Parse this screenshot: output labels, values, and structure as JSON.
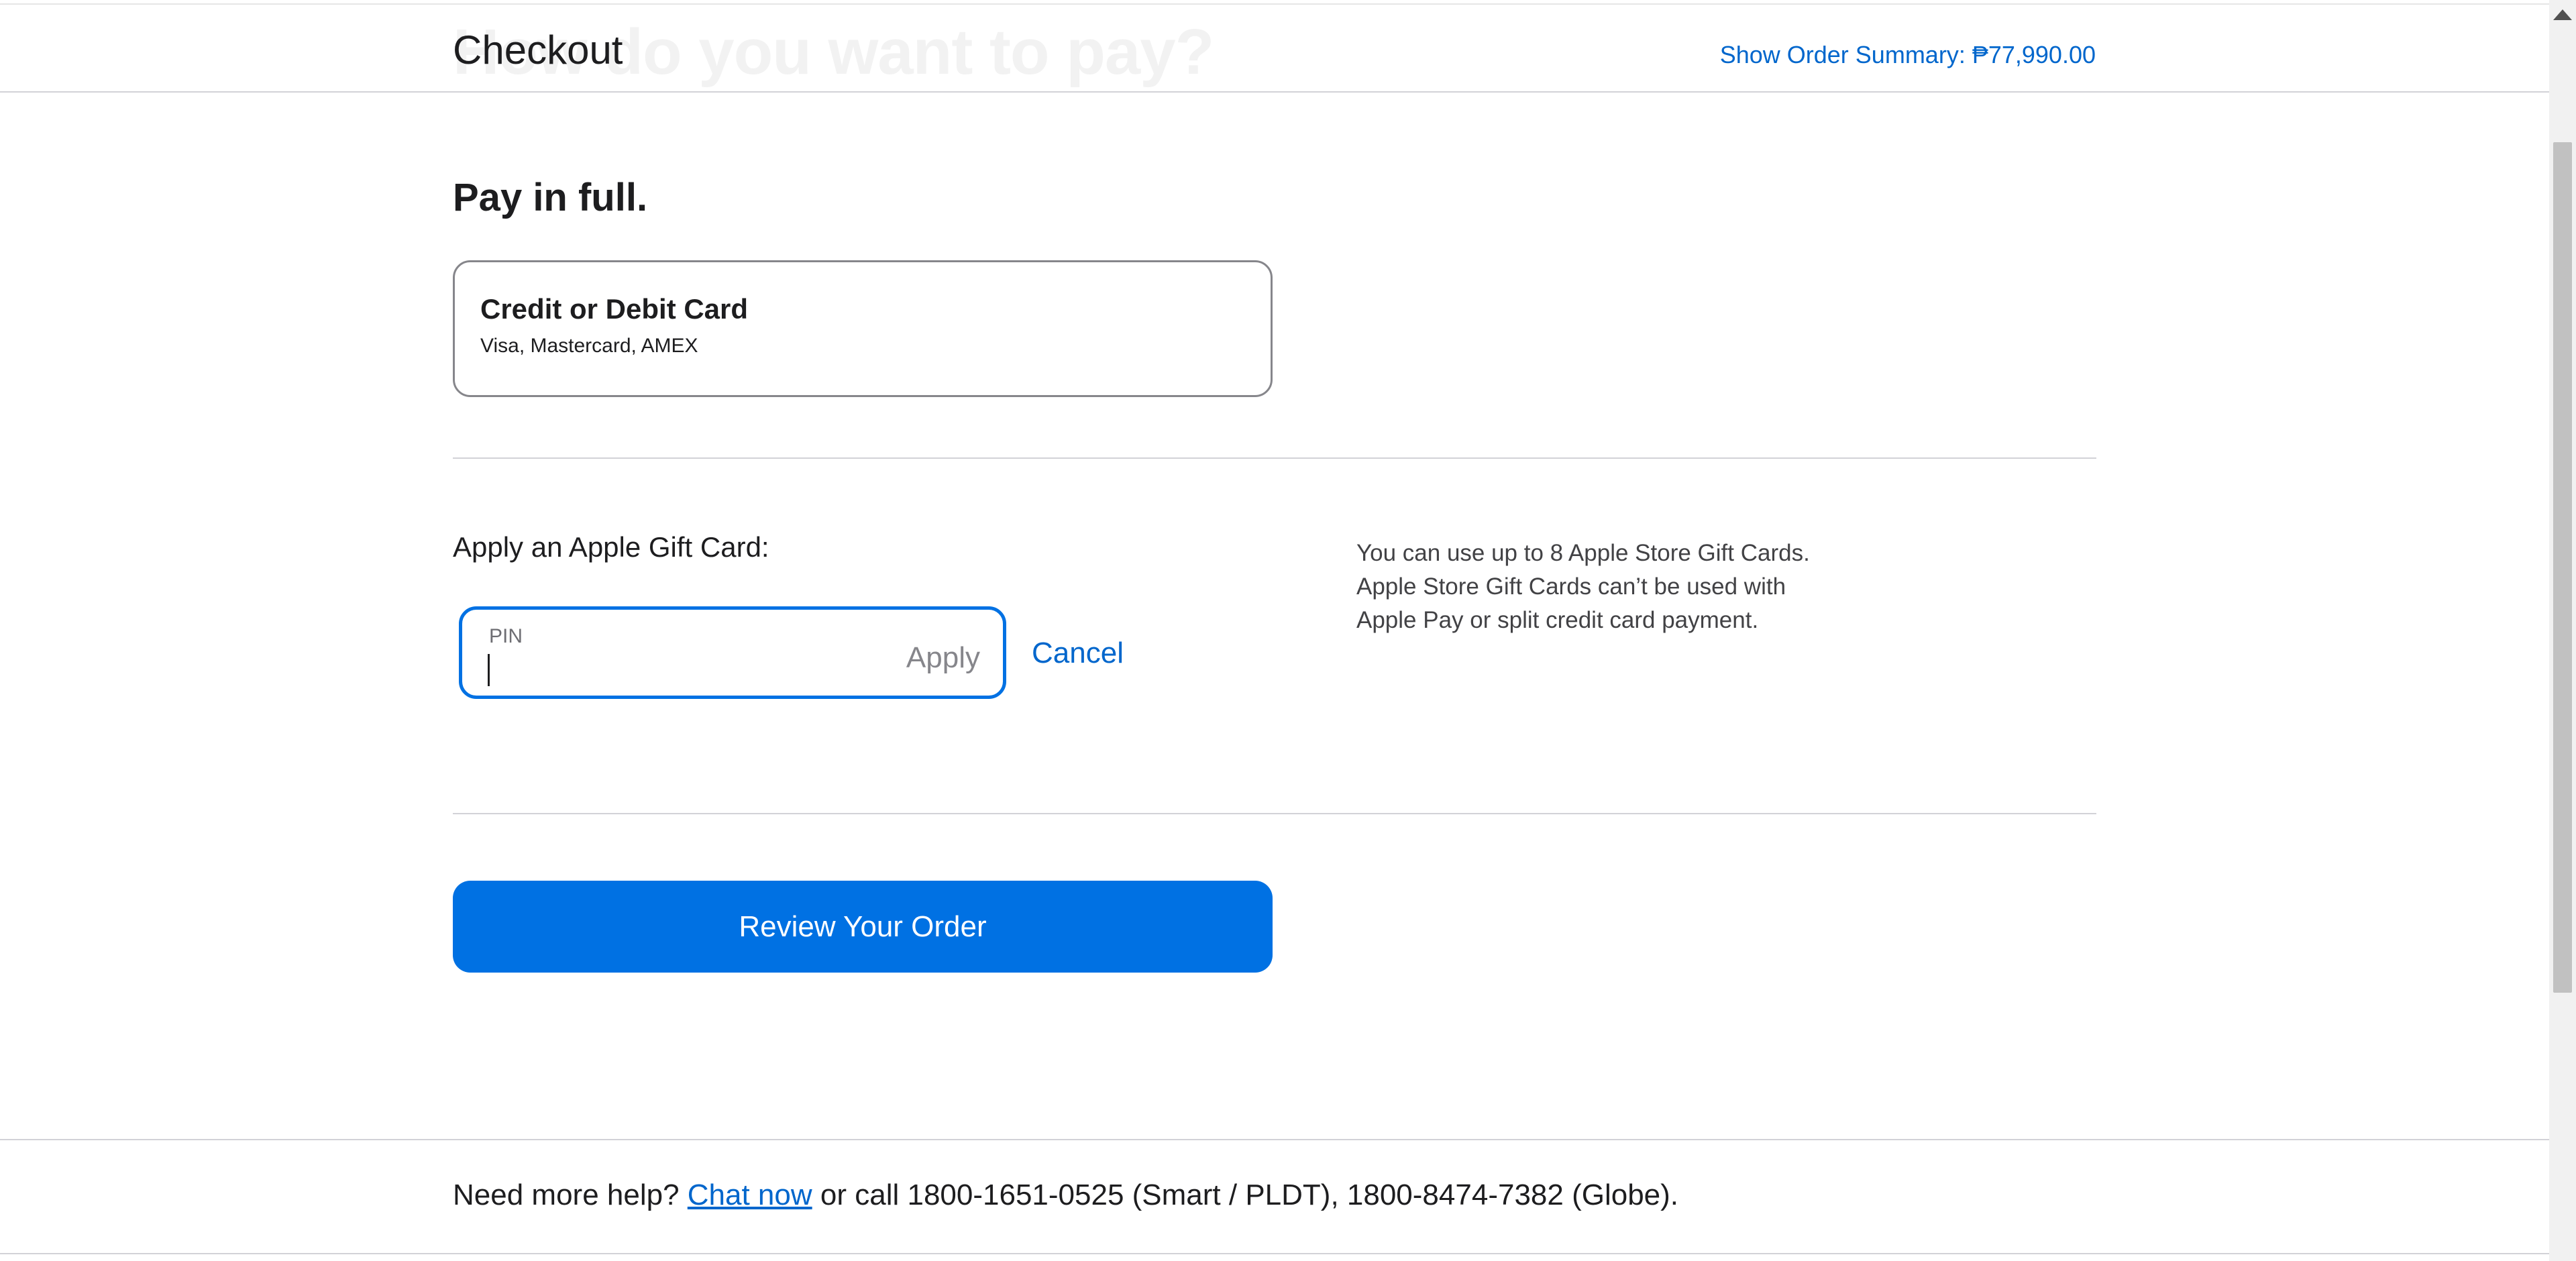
{
  "header": {
    "ghost_heading": "How do you want to pay?",
    "title": "Checkout",
    "order_summary_link": "Show Order Summary: ₱77,990.00"
  },
  "payment": {
    "section_title": "Pay in full.",
    "option": {
      "title": "Credit or Debit Card",
      "subtitle": "Visa, Mastercard, AMEX"
    }
  },
  "gift_card": {
    "label": "Apply an Apple Gift Card:",
    "pin_label": "PIN",
    "pin_value": "",
    "apply_label": "Apply",
    "cancel_label": "Cancel",
    "note_lines": [
      "You can use up to 8 Apple Store Gift Cards.",
      "Apple Store Gift Cards can’t be used with",
      "Apple Pay or split credit card payment."
    ]
  },
  "review_button": "Review Your Order",
  "footer": {
    "help_prefix": "Need more help? ",
    "chat_link": "Chat now",
    "help_suffix": " or call 1800-1651-0525 (Smart / PLDT), 1800-8474-7382 (Globe)."
  },
  "colors": {
    "accent": "#0071e3",
    "link": "#0066cc",
    "text": "#1d1d1f"
  }
}
